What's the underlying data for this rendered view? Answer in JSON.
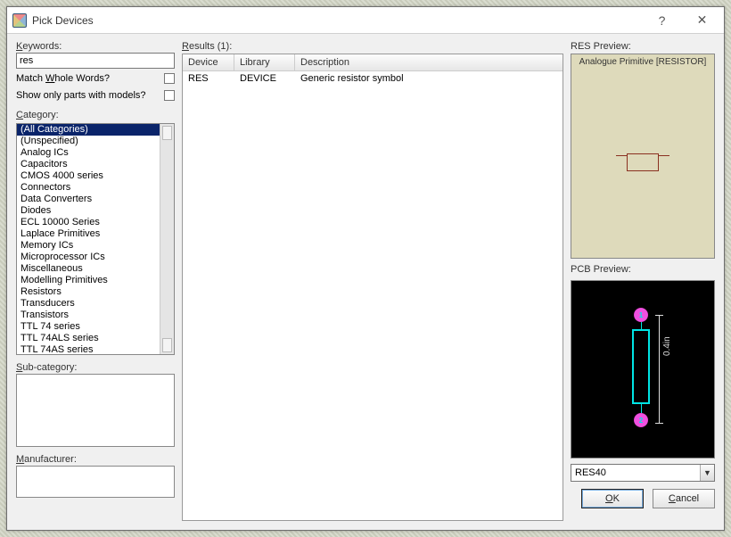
{
  "title": "Pick Devices",
  "left": {
    "keywords_label": "Keywords:",
    "keywords_value": "res",
    "match_whole_label": "Match Whole Words?",
    "show_models_label": "Show only parts with models?",
    "category_label": "Category:",
    "categories": [
      "(All Categories)",
      "(Unspecified)",
      "Analog ICs",
      "Capacitors",
      "CMOS 4000 series",
      "Connectors",
      "Data Converters",
      "Diodes",
      "ECL 10000 Series",
      "Laplace Primitives",
      "Memory ICs",
      "Microprocessor ICs",
      "Miscellaneous",
      "Modelling Primitives",
      "Resistors",
      "Transducers",
      "Transistors",
      "TTL 74 series",
      "TTL 74ALS series",
      "TTL 74AS series"
    ],
    "subcategory_label": "Sub-category:",
    "manufacturer_label": "Manufacturer:"
  },
  "mid": {
    "results_label": "Results (1):",
    "cols": {
      "c1": "Device",
      "c2": "Library",
      "c3": "Description"
    },
    "rows": [
      {
        "device": "RES",
        "library": "DEVICE",
        "desc": "Generic resistor symbol"
      }
    ]
  },
  "right": {
    "res_label": "RES Preview:",
    "res_title": "Analogue Primitive [RESISTOR]",
    "pcb_label": "PCB Preview:",
    "pcb_dim": "0.4in",
    "pcb_pad1": "1",
    "pcb_pad2": "2",
    "footprint_selected": "RES40",
    "ok": "OK",
    "cancel": "Cancel"
  }
}
